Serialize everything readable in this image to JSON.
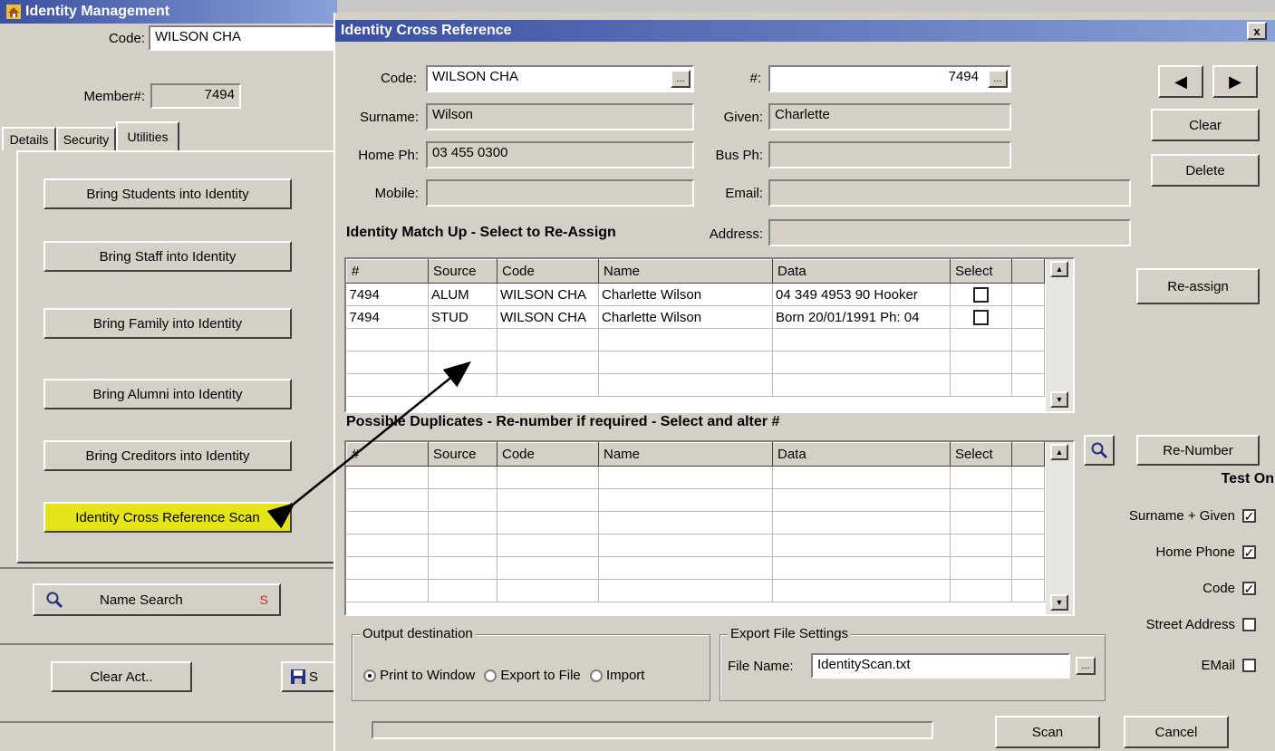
{
  "identity_management": {
    "title": "Identity Management",
    "code_label": "Code:",
    "code_value": "WILSON CHA",
    "member_label": "Member#:",
    "member_value": "7494",
    "tabs": [
      "Details",
      "Security",
      "Utilities"
    ],
    "buttons": [
      "Bring Students into Identity",
      "Bring Staff into Identity",
      "Bring Family into Identity",
      "Bring Alumni into Identity",
      "Bring Creditors into Identity",
      "Identity Cross Reference Scan"
    ],
    "name_search": "Name Search",
    "name_search_hotkey": "S",
    "clear_act": "Clear Act..",
    "save_partial": "S"
  },
  "dialog": {
    "title": "Identity Cross Reference",
    "close": "x",
    "code_label": "Code:",
    "code_value": "WILSON CHA",
    "hash_label": "#:",
    "hash_value": "7494",
    "surname_label": "Surname:",
    "surname_value": "Wilson",
    "given_label": "Given:",
    "given_value": "Charlette",
    "homeph_label": "Home Ph:",
    "homeph_value": "03 455 0300",
    "busph_label": "Bus Ph:",
    "busph_value": "",
    "mobile_label": "Mobile:",
    "mobile_value": "",
    "email_label": "Email:",
    "email_value": "",
    "address_label": "Address:",
    "address_value": "",
    "ellipsis": "...",
    "buttons": {
      "prev": "◀",
      "next": "▶",
      "clear": "Clear",
      "delete": "Delete",
      "reassign": "Re-assign",
      "renumber": "Re-Number",
      "scan": "Scan",
      "cancel": "Cancel"
    },
    "matchup_title": "Identity Match Up - Select to Re-Assign",
    "columns": [
      "#",
      "Source",
      "Code",
      "Name",
      "Data",
      "Select"
    ],
    "matchup_rows": [
      {
        "num": "7494",
        "source": "ALUM",
        "code": "WILSON CHA",
        "name": "Charlette Wilson",
        "data": "04 349 4953 90 Hooker"
      },
      {
        "num": "7494",
        "source": "STUD",
        "code": "WILSON CHA",
        "name": "Charlette Wilson",
        "data": "Born 20/01/1991 Ph: 04"
      }
    ],
    "duplicates_title": "Possible Duplicates - Re-number if required - Select and alter #",
    "test_on_title": "Test On",
    "tests": [
      {
        "label": "Surname + Given",
        "checked": true
      },
      {
        "label": "Home Phone",
        "checked": true
      },
      {
        "label": "Code",
        "checked": true
      },
      {
        "label": "Street Address",
        "checked": false
      },
      {
        "label": "EMail",
        "checked": false
      }
    ],
    "output_title": "Output destination",
    "output_options": [
      {
        "label": "Print to Window",
        "selected": true
      },
      {
        "label": "Export to File",
        "selected": false
      },
      {
        "label": "Import",
        "selected": false
      }
    ],
    "export_title": "Export  File Settings",
    "file_name_label": "File Name:",
    "file_name_value": "IdentityScan.txt"
  },
  "colors": {
    "highlight_button": "#e4e418",
    "titlebar": "#3a4fa0",
    "hotkey": "#e02020"
  },
  "icons": [
    "home-icon",
    "magnifier-icon",
    "floppy-disk-icon",
    "close-icon",
    "arrow-left-icon",
    "arrow-right-icon"
  ]
}
